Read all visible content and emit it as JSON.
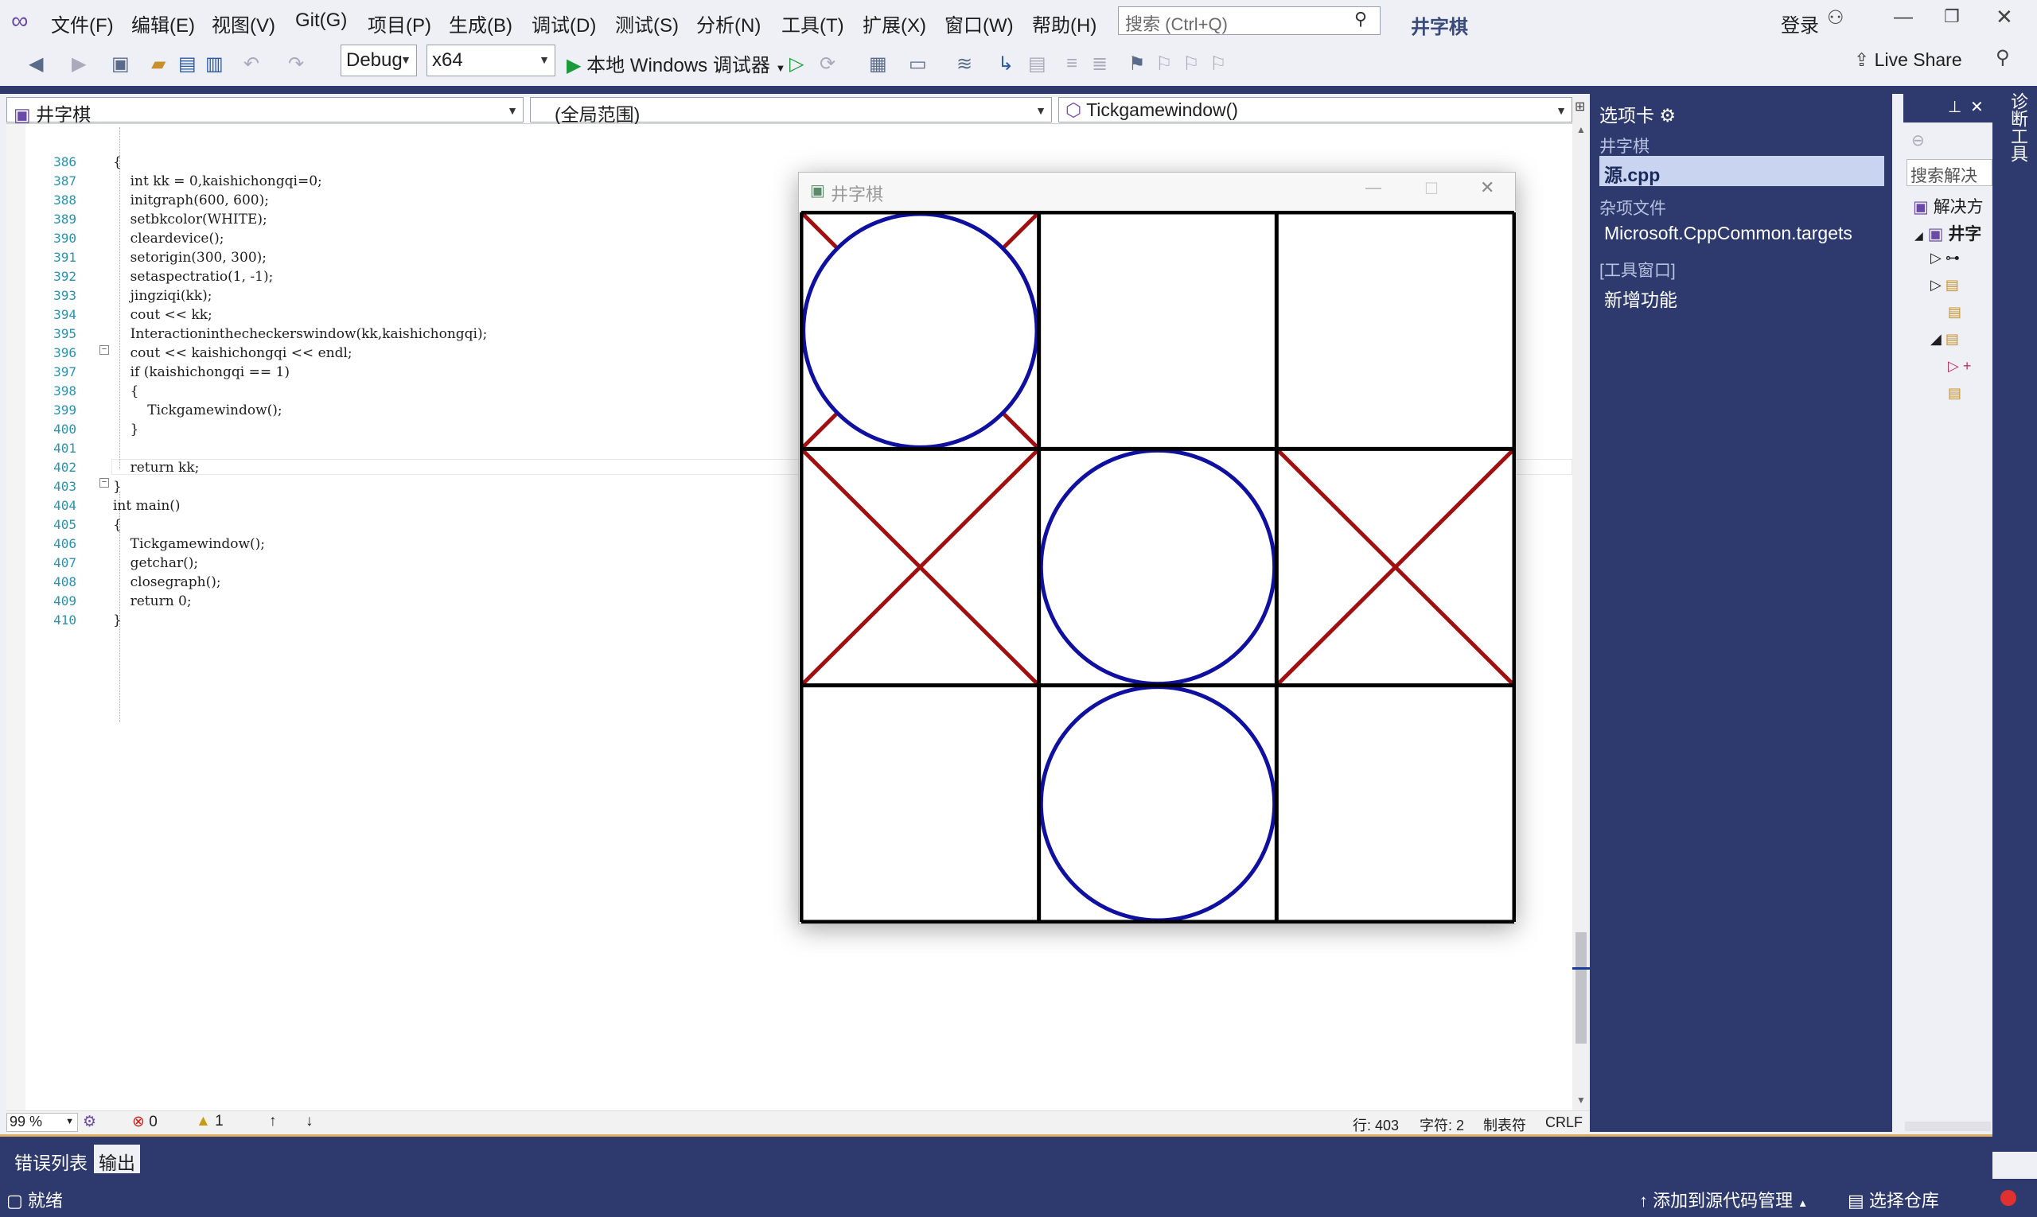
{
  "menu": [
    "文件(F)",
    "编辑(E)",
    "视图(V)",
    "Git(G)",
    "项目(P)",
    "生成(B)",
    "调试(D)",
    "测试(S)",
    "分析(N)",
    "工具(T)",
    "扩展(X)",
    "窗口(W)",
    "帮助(H)"
  ],
  "search": {
    "placeholder": "搜索 (Ctrl+Q)"
  },
  "app_title": "井字棋",
  "login": "登录",
  "live_share": "Live Share",
  "toolbar": {
    "config": "Debug",
    "platform": "x64",
    "run_label": "本地 Windows 调试器"
  },
  "nav": {
    "project": "井字棋",
    "scope": "(全局范围)",
    "member": "Tickgamewindow()"
  },
  "code_lines": [
    {
      "n": "386",
      "text": "{"
    },
    {
      "n": "387",
      "text": "    int kk = 0,kaishichongqi=0;"
    },
    {
      "n": "388",
      "text": "    initgraph(600, 600);"
    },
    {
      "n": "389",
      "text": "    setbkcolor(WHITE);"
    },
    {
      "n": "390",
      "text": "    cleardevice();"
    },
    {
      "n": "391",
      "text": "    setorigin(300, 300);"
    },
    {
      "n": "392",
      "text": "    setaspectratio(1, -1);"
    },
    {
      "n": "393",
      "text": "    jingziqi(kk);"
    },
    {
      "n": "394",
      "text": "    cout << kk;"
    },
    {
      "n": "395",
      "text": "    Interactioninthecheckerswindow(kk,kaishichongqi);"
    },
    {
      "n": "396",
      "text": "    cout << kaishichongqi << endl;"
    },
    {
      "n": "397",
      "text": "    if (kaishichongqi == 1)"
    },
    {
      "n": "398",
      "text": "    {"
    },
    {
      "n": "399",
      "text": "        Tickgamewindow();"
    },
    {
      "n": "400",
      "text": "    }"
    },
    {
      "n": "401",
      "text": ""
    },
    {
      "n": "402",
      "text": "    return kk;"
    },
    {
      "n": "403",
      "text": "}"
    },
    {
      "n": "404",
      "text": "int main()"
    },
    {
      "n": "405",
      "text": "{"
    },
    {
      "n": "406",
      "text": "    Tickgamewindow();"
    },
    {
      "n": "407",
      "text": "    getchar();"
    },
    {
      "n": "408",
      "text": "    closegraph();"
    },
    {
      "n": "409",
      "text": "    return 0;"
    },
    {
      "n": "410",
      "text": "}"
    }
  ],
  "editor_status": {
    "zoom": "99 %",
    "errors": "0",
    "warnings": "1",
    "row": "行: 403",
    "col": "字符: 2",
    "indent": "制表符",
    "eol": "CRLF"
  },
  "tabs_panel": {
    "title": "选项卡",
    "group1": "井字棋",
    "active_file": "源.cpp",
    "group2": "杂项文件",
    "misc_file": "Microsoft.CppCommon.targets",
    "group3": "[工具窗口]",
    "tool_item": "新增功能"
  },
  "solution_panel": {
    "search": "搜索解决",
    "title": "解决方",
    "project": "井字"
  },
  "side_strip": "诊断工具",
  "bottom_tabs": [
    "错误列表",
    "输出"
  ],
  "status": {
    "ready": "就绪",
    "source_control": "添加到源代码管理",
    "repo": "选择仓库"
  },
  "game": {
    "title": "井字棋",
    "board": [
      [
        "O",
        "",
        ""
      ],
      [
        "X",
        "O",
        "X"
      ],
      [
        "",
        "O",
        ""
      ]
    ],
    "colors": {
      "x": "#a01010",
      "o": "#1010a0",
      "grid": "#000000"
    }
  }
}
